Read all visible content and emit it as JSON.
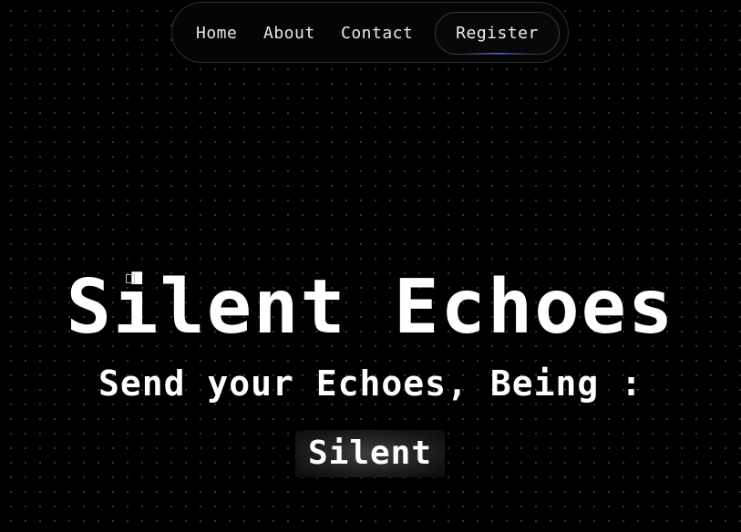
{
  "nav": {
    "links": [
      {
        "label": "Home"
      },
      {
        "label": "About"
      },
      {
        "label": "Contact"
      }
    ],
    "register_label": "Register",
    "register_glow_color": "#4f6bff"
  },
  "hero": {
    "title": "Silent Echoes",
    "subtitle": "Send your Echoes, Being :",
    "rotating_word": "Silent"
  },
  "theme": {
    "background": "#000000",
    "text": "#ffffff",
    "dot_grid": "#ffffff"
  }
}
